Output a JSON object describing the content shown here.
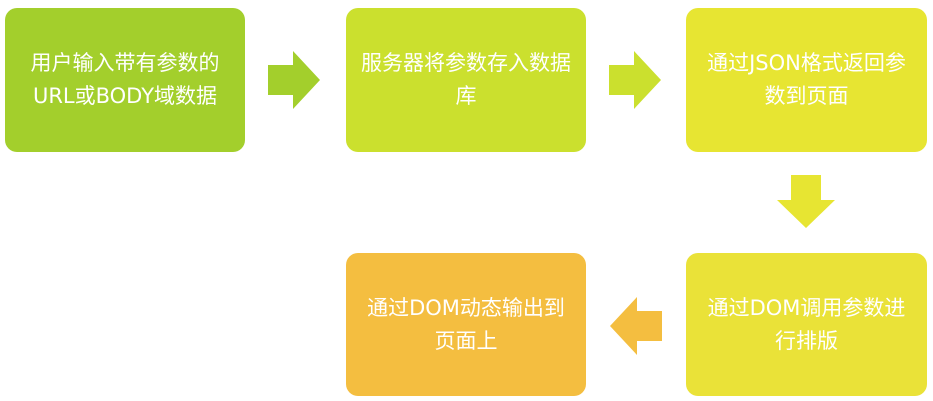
{
  "colors": {
    "step1": "#a3cf2c",
    "step2": "#cbe02e",
    "step3": "#e7e532",
    "step4": "#eae238",
    "step5": "#f4be40",
    "arrow1": "#a3cf2c",
    "arrow2": "#cbe02e",
    "arrow3": "#e7e532",
    "arrow4": "#f4be40"
  },
  "steps": [
    {
      "text": "用户输入带有参数的URL或BODY域数据"
    },
    {
      "text": "服务器将参数存入数据库"
    },
    {
      "text": "通过JSON格式返回参数到页面"
    },
    {
      "text": "通过DOM调用参数进行排版"
    },
    {
      "text": "通过DOM动态输出到页面上"
    }
  ],
  "icons": {
    "arrow1": "arrow-right-icon",
    "arrow2": "arrow-right-icon",
    "arrow3": "arrow-down-icon",
    "arrow4": "arrow-left-icon"
  }
}
